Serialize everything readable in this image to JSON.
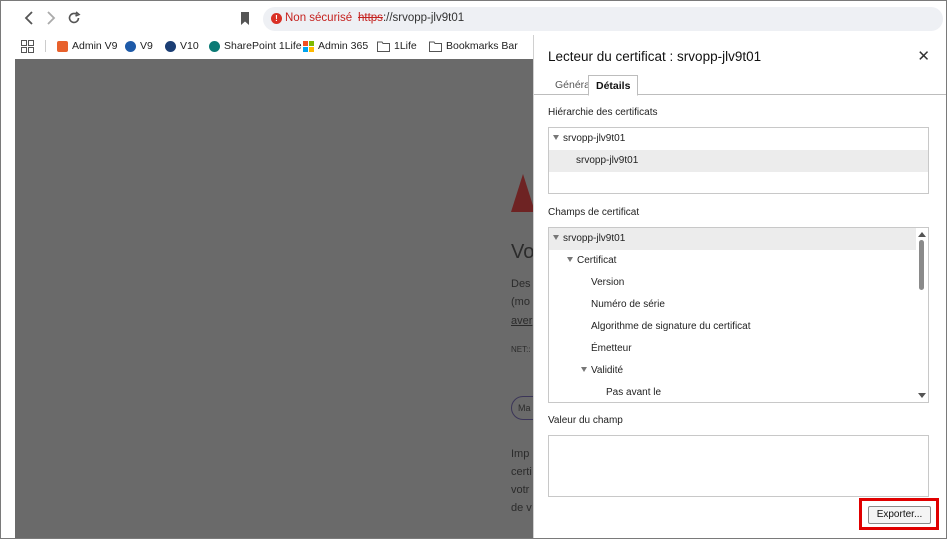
{
  "browser": {
    "security_label": "Non sécurisé",
    "url_scheme": "https",
    "url_rest": "://srvopp-jlv9t01"
  },
  "bookmarks": [
    {
      "label": "Admin V9",
      "color": "#e8612c"
    },
    {
      "label": "V9",
      "color": "#1e5aa8"
    },
    {
      "label": "V10",
      "color": "#1b3e74"
    },
    {
      "label": "SharePoint 1Life",
      "color": "#0b7a75"
    },
    {
      "label": "Admin 365",
      "color": "#f25022"
    },
    {
      "label": "1Life",
      "color": "#666666"
    },
    {
      "label": "Bookmarks Bar",
      "color": "#666666"
    }
  ],
  "page": {
    "heading_fragment": "Vo",
    "lines": [
      "Des",
      "(mo",
      "aver",
      "NET::",
      "Imp",
      "certi",
      "votr",
      "de v"
    ],
    "pill": "Ma"
  },
  "dialog": {
    "title": "Lecteur du certificat : srvopp-jlv9t01",
    "tabs": [
      "Général",
      "Détails"
    ],
    "hierarchy_label": "Hiérarchie des certificats",
    "hierarchy": [
      "srvopp-jlv9t01",
      "srvopp-jlv9t01"
    ],
    "fields_label": "Champs de certificat",
    "fields": [
      {
        "label": "srvopp-jlv9t01",
        "level": 0,
        "expanded": true
      },
      {
        "label": "Certificat",
        "level": 1,
        "expanded": true
      },
      {
        "label": "Version",
        "level": 2,
        "expanded": false
      },
      {
        "label": "Numéro de série",
        "level": 2,
        "expanded": false
      },
      {
        "label": "Algorithme de signature du certificat",
        "level": 2,
        "expanded": false
      },
      {
        "label": "Émetteur",
        "level": 2,
        "expanded": false
      },
      {
        "label": "Validité",
        "level": 2,
        "expanded": true
      },
      {
        "label": "Pas avant le",
        "level": 3,
        "expanded": false
      }
    ],
    "value_label": "Valeur du champ",
    "value": "",
    "export_label": "Exporter..."
  }
}
